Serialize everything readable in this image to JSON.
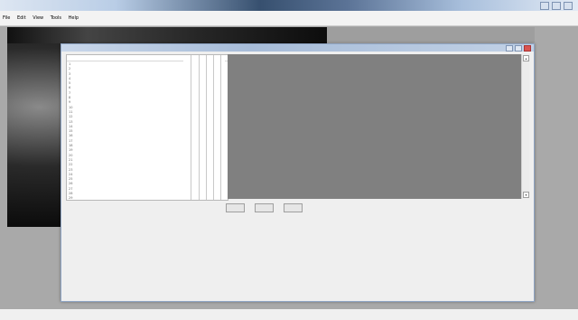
{
  "app": {
    "title": "",
    "menu": [
      "File",
      "Edit",
      "View",
      "Tools",
      "Help"
    ]
  },
  "dialog": {
    "title": "",
    "list_header": "",
    "row_numbers": [
      "1",
      "2",
      "3",
      "4",
      "5",
      "6",
      "7",
      "8",
      "9",
      "10",
      "11",
      "12",
      "13",
      "14",
      "15",
      "16",
      "17",
      "18",
      "19",
      "20",
      "21",
      "22",
      "23",
      "24",
      "25",
      "26",
      "27",
      "28",
      "29"
    ],
    "buttons": [
      "",
      "",
      ""
    ]
  },
  "statusbar": {
    "text": ""
  },
  "colors": {
    "preview_bg": "#808080",
    "dialog_border": "#8ea4c3",
    "dark_panel": "#0c0c0c"
  },
  "icons": [
    "window-minimize-icon",
    "window-maximize-icon",
    "window-close-icon",
    "scroll-up-icon",
    "scroll-down-icon"
  ]
}
